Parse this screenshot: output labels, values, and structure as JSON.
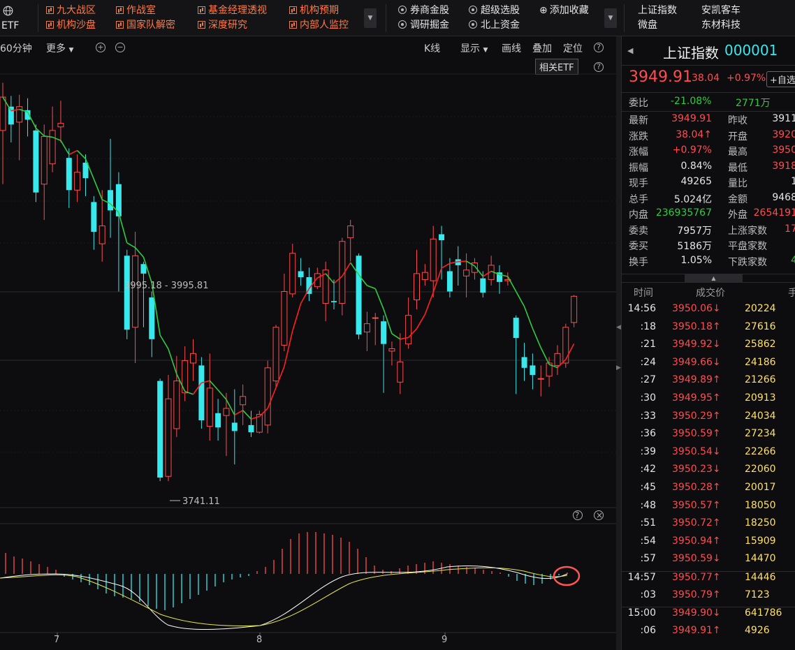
{
  "topbar": {
    "etf_label": "ETF",
    "orange_links": [
      {
        "label": "九大战区"
      },
      {
        "label": "作战室"
      },
      {
        "label": "基金经理透视"
      },
      {
        "label": "机构预期"
      },
      {
        "label": "机构沙盘"
      },
      {
        "label": "国家队解密"
      },
      {
        "label": "深度研究"
      },
      {
        "label": "内部人监控"
      }
    ],
    "circle_links": [
      {
        "label": "券商金股"
      },
      {
        "label": "超级选股"
      },
      {
        "label": "调研掘金"
      },
      {
        "label": "北上资金"
      }
    ],
    "add_favorite": "添加收藏",
    "quick_stocks": [
      "上证指数",
      "安凯客车",
      "微盘",
      "东材科技"
    ]
  },
  "toolbar": {
    "period": "60分钟",
    "more": "更多",
    "kline": "K线",
    "display": "显示",
    "draw": "画线",
    "overlay": "叠加",
    "locate": "定位",
    "help": "?",
    "related_etf": "相关ETF"
  },
  "chart": {
    "range_label": "3995.18 - 3995.81",
    "low_label": "3741.11",
    "x_labels": [
      "7",
      "8",
      "9"
    ],
    "colors": {
      "up": "#ff4d4f",
      "down": "#37e8ec",
      "ma_up": "#ff2020",
      "ma_down": "#2ecc40",
      "dif": "#ffffff",
      "dea": "#e8e84a"
    }
  },
  "chart_data": {
    "type": "candlestick",
    "ylim": [
      3720,
      4080
    ],
    "candles": [
      {
        "o": 4035,
        "c": 4063,
        "h": 4075,
        "l": 3990
      },
      {
        "o": 4055,
        "c": 4040,
        "h": 4064,
        "l": 4025
      },
      {
        "o": 4042,
        "c": 4055,
        "h": 4065,
        "l": 4010
      },
      {
        "o": 4052,
        "c": 4044,
        "h": 4062,
        "l": 4030
      },
      {
        "o": 4035,
        "c": 3983,
        "h": 4040,
        "l": 3975
      },
      {
        "o": 3990,
        "c": 4030,
        "h": 4040,
        "l": 3960
      },
      {
        "o": 4007,
        "c": 4035,
        "h": 4055,
        "l": 4000
      },
      {
        "o": 4038,
        "c": 4041,
        "h": 4060,
        "l": 4025
      },
      {
        "o": 4012,
        "c": 3985,
        "h": 4020,
        "l": 3970
      },
      {
        "o": 3985,
        "c": 4000,
        "h": 4015,
        "l": 3975
      },
      {
        "o": 4008,
        "c": 3995,
        "h": 4015,
        "l": 3980
      },
      {
        "o": 3975,
        "c": 3950,
        "h": 3980,
        "l": 3935
      },
      {
        "o": 3940,
        "c": 3955,
        "h": 3985,
        "l": 3925
      },
      {
        "o": 3985,
        "c": 3968,
        "h": 4028,
        "l": 3945
      },
      {
        "o": 3990,
        "c": 3963,
        "h": 4000,
        "l": 3900
      },
      {
        "o": 3930,
        "c": 3868,
        "h": 3935,
        "l": 3860
      },
      {
        "o": 3870,
        "c": 3930,
        "h": 3950,
        "l": 3840
      },
      {
        "o": 3923,
        "c": 3915,
        "h": 3925,
        "l": 3870
      },
      {
        "o": 3895,
        "c": 3860,
        "h": 3900,
        "l": 3845
      },
      {
        "o": 3825,
        "c": 3744,
        "h": 3827,
        "l": 3741
      },
      {
        "o": 3745,
        "c": 3810,
        "h": 3830,
        "l": 3741
      },
      {
        "o": 3785,
        "c": 3825,
        "h": 3846,
        "l": 3778
      },
      {
        "o": 3815,
        "c": 3842,
        "h": 3854,
        "l": 3808
      },
      {
        "o": 3840,
        "c": 3848,
        "h": 3860,
        "l": 3825
      },
      {
        "o": 3838,
        "c": 3792,
        "h": 3845,
        "l": 3785
      },
      {
        "o": 3787,
        "c": 3819,
        "h": 3848,
        "l": 3775
      },
      {
        "o": 3798,
        "c": 3786,
        "h": 3810,
        "l": 3775
      },
      {
        "o": 3796,
        "c": 3802,
        "h": 3815,
        "l": 3762
      },
      {
        "o": 3790,
        "c": 3783,
        "h": 3818,
        "l": 3755
      },
      {
        "o": 3805,
        "c": 3812,
        "h": 3822,
        "l": 3788
      },
      {
        "o": 3788,
        "c": 3782,
        "h": 3800,
        "l": 3778
      },
      {
        "o": 3782,
        "c": 3797,
        "h": 3800,
        "l": 3781
      },
      {
        "o": 3788,
        "c": 3836,
        "h": 3842,
        "l": 3781
      },
      {
        "o": 3825,
        "c": 3870,
        "h": 3872,
        "l": 3820
      },
      {
        "o": 3855,
        "c": 3900,
        "h": 3915,
        "l": 3850
      },
      {
        "o": 3898,
        "c": 3932,
        "h": 3940,
        "l": 3895
      },
      {
        "o": 3917,
        "c": 3912,
        "h": 3928,
        "l": 3905
      },
      {
        "o": 3912,
        "c": 3898,
        "h": 3920,
        "l": 3892
      },
      {
        "o": 3904,
        "c": 3915,
        "h": 3920,
        "l": 3902
      },
      {
        "o": 3890,
        "c": 3918,
        "h": 3925,
        "l": 3875
      },
      {
        "o": 3892,
        "c": 3891,
        "h": 3910,
        "l": 3885
      },
      {
        "o": 3890,
        "c": 3942,
        "h": 3945,
        "l": 3880
      },
      {
        "o": 3945,
        "c": 3955,
        "h": 3960,
        "l": 3925
      },
      {
        "o": 3930,
        "c": 3864,
        "h": 3932,
        "l": 3860
      },
      {
        "o": 3866,
        "c": 3873,
        "h": 3883,
        "l": 3850
      },
      {
        "o": 3878,
        "c": 3878,
        "h": 3882,
        "l": 3855
      },
      {
        "o": 3875,
        "c": 3856,
        "h": 3880,
        "l": 3815
      },
      {
        "o": 3850,
        "c": 3852,
        "h": 3858,
        "l": 3838
      },
      {
        "o": 3824,
        "c": 3841,
        "h": 3865,
        "l": 3814
      },
      {
        "o": 3856,
        "c": 3880,
        "h": 3895,
        "l": 3852
      },
      {
        "o": 3893,
        "c": 3915,
        "h": 3935,
        "l": 3885
      },
      {
        "o": 3910,
        "c": 3916,
        "h": 3923,
        "l": 3905
      },
      {
        "o": 3909,
        "c": 3944,
        "h": 3955,
        "l": 3895
      },
      {
        "o": 3948,
        "c": 3943,
        "h": 3955,
        "l": 3910
      },
      {
        "o": 3917,
        "c": 3900,
        "h": 3928,
        "l": 3895
      },
      {
        "o": 3927,
        "c": 3922,
        "h": 3938,
        "l": 3905
      },
      {
        "o": 3913,
        "c": 3918,
        "h": 3932,
        "l": 3895
      },
      {
        "o": 3916,
        "c": 3924,
        "h": 3928,
        "l": 3910
      },
      {
        "o": 3911,
        "c": 3899,
        "h": 3917,
        "l": 3895
      },
      {
        "o": 3910,
        "c": 3922,
        "h": 3930,
        "l": 3905
      },
      {
        "o": 3916,
        "c": 3908,
        "h": 3922,
        "l": 3898
      },
      {
        "o": 3909,
        "c": 3910,
        "h": 3916,
        "l": 3905
      },
      {
        "o": 3878,
        "c": 3861,
        "h": 3880,
        "l": 3814
      },
      {
        "o": 3845,
        "c": 3836,
        "h": 3857,
        "l": 3825
      },
      {
        "o": 3838,
        "c": 3830,
        "h": 3848,
        "l": 3818
      },
      {
        "o": 3827,
        "c": 3827,
        "h": 3838,
        "l": 3812
      },
      {
        "o": 3829,
        "c": 3840,
        "h": 3845,
        "l": 3820
      },
      {
        "o": 3838,
        "c": 3848,
        "h": 3855,
        "l": 3830
      },
      {
        "o": 3840,
        "c": 3870,
        "h": 3873,
        "l": 3836
      },
      {
        "o": 3874,
        "c": 3896,
        "h": 3897,
        "l": 3870
      }
    ]
  },
  "macd_bars": [
    {
      "x": 8,
      "v": 30
    },
    {
      "x": 20,
      "v": 25
    },
    {
      "x": 32,
      "v": 22
    },
    {
      "x": 44,
      "v": 18
    },
    {
      "x": 56,
      "v": 14
    },
    {
      "x": 68,
      "v": 10
    },
    {
      "x": 80,
      "v": 6
    },
    {
      "x": 92,
      "v": -4
    },
    {
      "x": 104,
      "v": -8
    },
    {
      "x": 116,
      "v": -12
    },
    {
      "x": 128,
      "v": -16
    },
    {
      "x": 140,
      "v": -22
    },
    {
      "x": 152,
      "v": -28
    },
    {
      "x": 164,
      "v": -32
    },
    {
      "x": 176,
      "v": -34
    },
    {
      "x": 188,
      "v": -36
    },
    {
      "x": 200,
      "v": -40
    },
    {
      "x": 212,
      "v": -46
    },
    {
      "x": 224,
      "v": -50
    },
    {
      "x": 236,
      "v": -52
    },
    {
      "x": 248,
      "v": -48
    },
    {
      "x": 260,
      "v": -42
    },
    {
      "x": 272,
      "v": -36
    },
    {
      "x": 284,
      "v": -30
    },
    {
      "x": 296,
      "v": -24
    },
    {
      "x": 308,
      "v": -18
    },
    {
      "x": 320,
      "v": -12
    },
    {
      "x": 332,
      "v": -8
    },
    {
      "x": 344,
      "v": -5
    },
    {
      "x": 356,
      "v": -3
    },
    {
      "x": 368,
      "v": 4
    },
    {
      "x": 380,
      "v": 10
    },
    {
      "x": 392,
      "v": 20
    },
    {
      "x": 404,
      "v": 36
    },
    {
      "x": 416,
      "v": 50
    },
    {
      "x": 428,
      "v": 58
    },
    {
      "x": 440,
      "v": 60
    },
    {
      "x": 452,
      "v": 60
    },
    {
      "x": 464,
      "v": 58
    },
    {
      "x": 476,
      "v": 56
    },
    {
      "x": 488,
      "v": 52
    },
    {
      "x": 500,
      "v": 46
    },
    {
      "x": 512,
      "v": 36
    },
    {
      "x": 524,
      "v": 24
    },
    {
      "x": 536,
      "v": 12
    },
    {
      "x": 548,
      "v": 6
    },
    {
      "x": 560,
      "v": 4
    },
    {
      "x": 572,
      "v": 8
    },
    {
      "x": 584,
      "v": 12
    },
    {
      "x": 596,
      "v": 14
    },
    {
      "x": 608,
      "v": 16
    },
    {
      "x": 620,
      "v": 18
    },
    {
      "x": 632,
      "v": 16
    },
    {
      "x": 644,
      "v": 14
    },
    {
      "x": 656,
      "v": 12
    },
    {
      "x": 668,
      "v": 10
    },
    {
      "x": 680,
      "v": 8
    },
    {
      "x": 692,
      "v": 6
    },
    {
      "x": 704,
      "v": 4
    },
    {
      "x": 716,
      "v": 2
    },
    {
      "x": 728,
      "v": -4
    },
    {
      "x": 740,
      "v": -10
    },
    {
      "x": 752,
      "v": -14
    },
    {
      "x": 764,
      "v": -16
    },
    {
      "x": 776,
      "v": -14
    },
    {
      "x": 788,
      "v": -8
    },
    {
      "x": 800,
      "v": -2
    },
    {
      "x": 812,
      "v": 2
    }
  ],
  "panel": {
    "title": "上证指数",
    "code": "000001",
    "price": "3949.91",
    "change": "38.04",
    "change_pct": "+0.97%",
    "add_watch": "+自选",
    "weibi_label": "委比",
    "weibi_value": "-21.08%",
    "weicha_value": "2771万",
    "stats": [
      {
        "l1": "最新",
        "v1": "3949.91",
        "c1": "red",
        "l2": "昨收",
        "v2": "3911",
        "c2": "white"
      },
      {
        "l1": "涨跌",
        "v1": "38.04↑",
        "c1": "red",
        "l2": "开盘",
        "v2": "3920",
        "c2": "red"
      },
      {
        "l1": "涨幅",
        "v1": "+0.97%",
        "c1": "red",
        "l2": "最高",
        "v2": "3950",
        "c2": "red"
      },
      {
        "l1": "振幅",
        "v1": "0.84%",
        "c1": "white",
        "l2": "最低",
        "v2": "3918",
        "c2": "red"
      },
      {
        "l1": "现手",
        "v1": "49265",
        "c1": "white",
        "l2": "量比",
        "v2": "1",
        "c2": "white"
      },
      {
        "l1": "总手",
        "v1": "5.024亿",
        "c1": "white",
        "l2": "金额",
        "v2": "9468",
        "c2": "white"
      },
      {
        "l1": "内盘",
        "v1": "236935767",
        "c1": "green",
        "l2": "外盘",
        "v2": "2654191",
        "c2": "red"
      },
      {
        "l1": "委卖",
        "v1": "7957万",
        "c1": "white",
        "l2": "上涨家数",
        "v2": "17",
        "c2": "red"
      },
      {
        "l1": "委买",
        "v1": "5186万",
        "c1": "white",
        "l2": "平盘家数",
        "v2": "",
        "c2": "white"
      },
      {
        "l1": "换手",
        "v1": "1.05%",
        "c1": "white",
        "l2": "下跌家数",
        "v2": "4",
        "c2": "green"
      }
    ],
    "ticks_header": {
      "time": "时间",
      "price": "成交价",
      "vol": "手"
    },
    "ticks": [
      {
        "t": "14:56",
        "p": "3950.06↓",
        "pc": "red",
        "v": "20224"
      },
      {
        "t": ":18",
        "p": "3950.18↑",
        "pc": "red",
        "v": "27616"
      },
      {
        "t": ":21",
        "p": "3949.92↓",
        "pc": "red",
        "v": "25862"
      },
      {
        "t": ":24",
        "p": "3949.66↓",
        "pc": "red",
        "v": "24186"
      },
      {
        "t": ":27",
        "p": "3949.89↑",
        "pc": "red",
        "v": "21266"
      },
      {
        "t": ":30",
        "p": "3949.95↑",
        "pc": "red",
        "v": "20913"
      },
      {
        "t": ":33",
        "p": "3950.29↑",
        "pc": "red",
        "v": "24034"
      },
      {
        "t": ":36",
        "p": "3950.59↑",
        "pc": "red",
        "v": "27234"
      },
      {
        "t": ":39",
        "p": "3950.54↓",
        "pc": "red",
        "v": "22266"
      },
      {
        "t": ":42",
        "p": "3950.23↓",
        "pc": "red",
        "v": "22060"
      },
      {
        "t": ":45",
        "p": "3950.28↑",
        "pc": "red",
        "v": "20017"
      },
      {
        "t": ":48",
        "p": "3950.57↑",
        "pc": "red",
        "v": "18050"
      },
      {
        "t": ":51",
        "p": "3950.72↑",
        "pc": "red",
        "v": "18250"
      },
      {
        "t": ":54",
        "p": "3950.94↑",
        "pc": "red",
        "v": "15909"
      },
      {
        "t": ":57",
        "p": "3950.59↓",
        "pc": "red",
        "v": "14470"
      },
      {
        "t": "14:57",
        "p": "3950.77↑",
        "pc": "red",
        "v": "14446"
      },
      {
        "t": ":03",
        "p": "3950.79↑",
        "pc": "red",
        "v": "7123"
      },
      {
        "t": "15:00",
        "p": "3949.90↓",
        "pc": "red",
        "v": "641786"
      },
      {
        "t": ":06",
        "p": "3949.91↑",
        "pc": "red",
        "v": "4926"
      }
    ]
  }
}
